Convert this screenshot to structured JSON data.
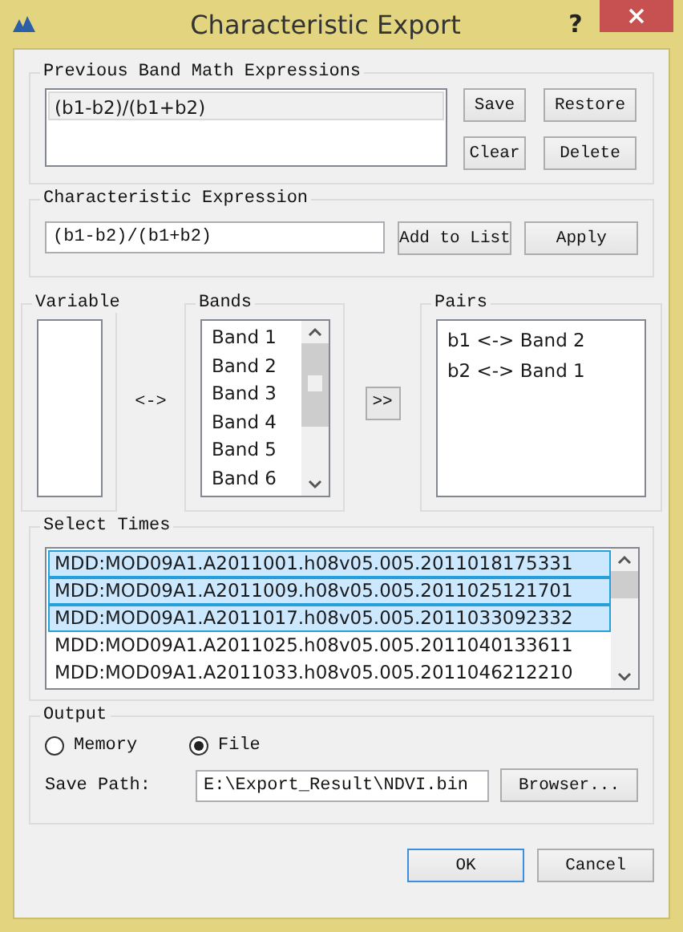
{
  "window": {
    "title": "Characteristic Export",
    "help": "?"
  },
  "previous_expressions": {
    "title": "Previous Band Math Expressions",
    "items": [
      {
        "text": "(b1-b2)/(b1+b2)",
        "selected": true
      }
    ],
    "buttons": [
      "Save",
      "Restore",
      "Clear",
      "Delete"
    ]
  },
  "characteristic_expression": {
    "title": "Characteristic Expression",
    "value": "(b1-b2)/(b1+b2)",
    "buttons": [
      "Add to List",
      "Apply"
    ]
  },
  "variable": {
    "title": "Variable"
  },
  "link_symbol": "<->",
  "bands": {
    "title": "Bands",
    "items": [
      "Band 1",
      "Band 2",
      "Band 3",
      "Band 4",
      "Band 5",
      "Band 6"
    ]
  },
  "move_button": ">>",
  "pairs": {
    "title": "Pairs",
    "items": [
      "b1 <-> Band 2",
      "b2 <-> Band 1"
    ]
  },
  "select_times": {
    "title": "Select Times",
    "items": [
      {
        "text": "MDD:MOD09A1.A2011001.h08v05.005.2011018175331",
        "selected": true
      },
      {
        "text": "MDD:MOD09A1.A2011009.h08v05.005.2011025121701",
        "selected": true
      },
      {
        "text": "MDD:MOD09A1.A2011017.h08v05.005.2011033092332",
        "selected": true
      },
      {
        "text": "MDD:MOD09A1.A2011025.h08v05.005.2011040133611",
        "selected": false
      },
      {
        "text": "MDD:MOD09A1.A2011033.h08v05.005.2011046212210",
        "selected": false
      }
    ]
  },
  "output": {
    "title": "Output",
    "options": [
      {
        "label": "Memory",
        "selected": false
      },
      {
        "label": "File",
        "selected": true
      }
    ],
    "save_path_label": "Save Path:",
    "save_path": "E:\\Export_Result\\NDVI.bin",
    "browse_button": "Browser..."
  },
  "buttons": [
    {
      "label": "OK",
      "default": true
    },
    {
      "label": "Cancel",
      "default": false
    }
  ]
}
